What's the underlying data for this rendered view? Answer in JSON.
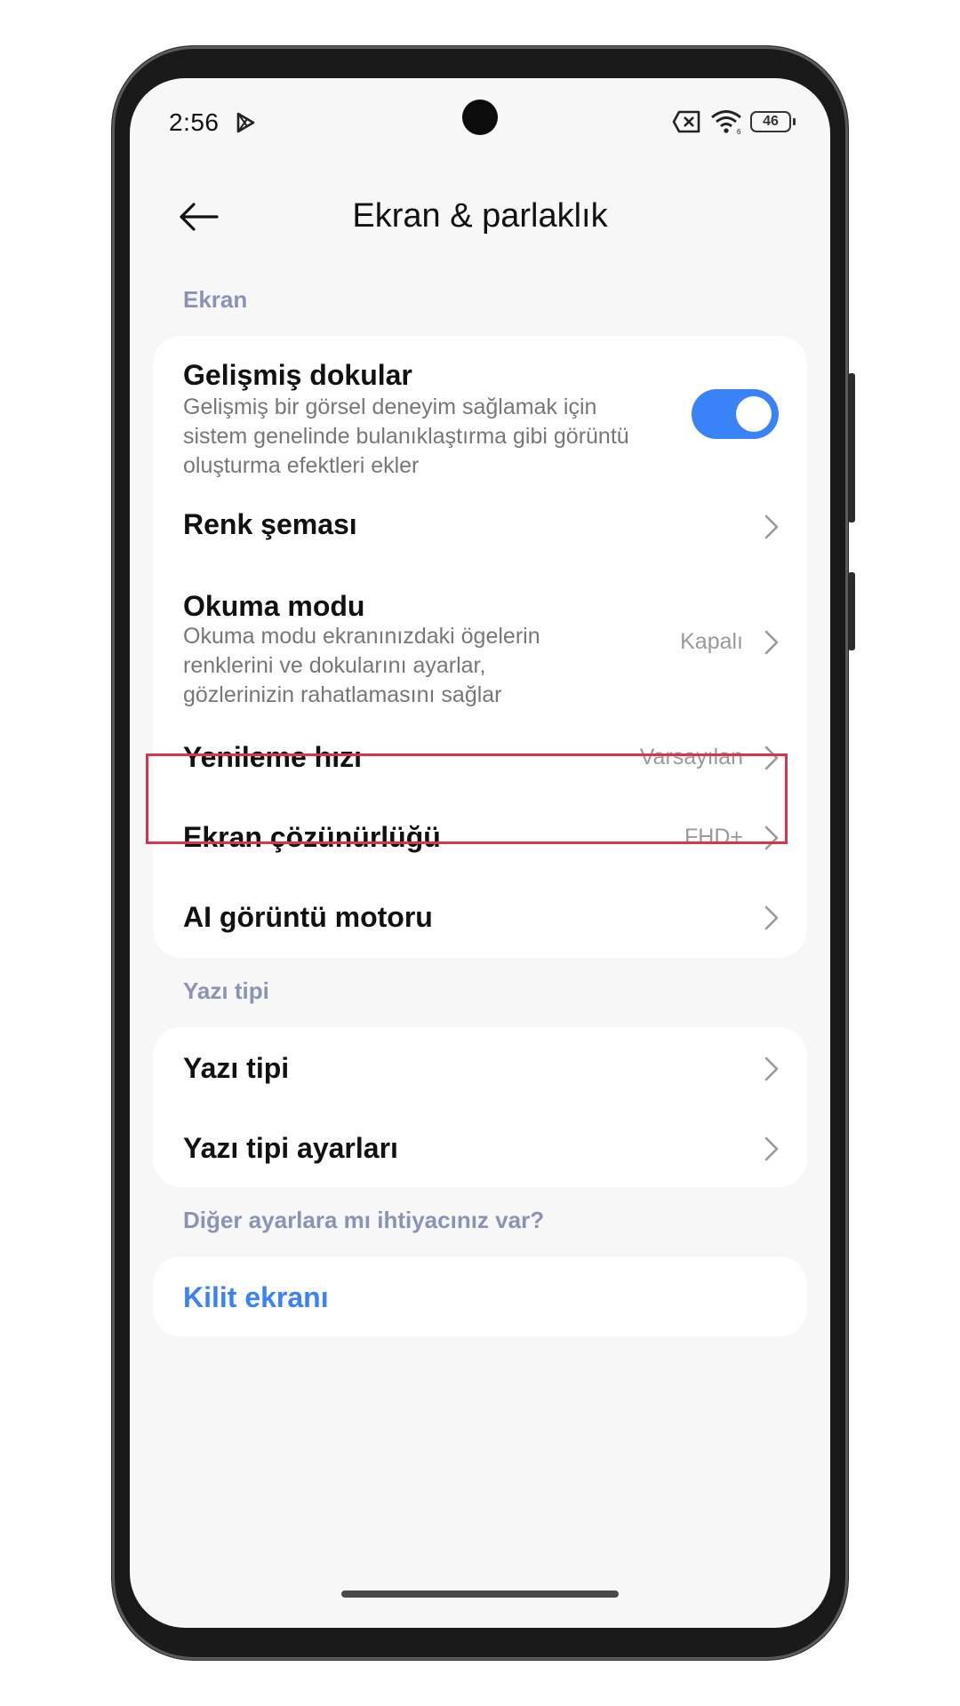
{
  "status_bar": {
    "time": "2:56",
    "battery_level": "46",
    "icons": [
      "play-store-icon",
      "sim-x-icon",
      "wifi-icon",
      "battery-icon"
    ]
  },
  "header": {
    "title": "Ekran & parlaklık",
    "back_icon": "arrow-left-icon"
  },
  "sections": {
    "ekran": {
      "label": "Ekran",
      "items": {
        "gelismis": {
          "title": "Gelişmiş dokular",
          "description": "Gelişmiş bir görsel deneyim sağlamak için sistem genelinde bulanıklaştırma gibi görüntü oluşturma efektleri ekler",
          "toggle_on": true
        },
        "renk": {
          "title": "Renk şeması"
        },
        "okuma": {
          "title": "Okuma modu",
          "description": "Okuma modu ekranınızdaki ögelerin renklerini ve dokularını ayarlar, gözlerinizin rahatlamasını sağlar",
          "value": "Kapalı"
        },
        "yenileme": {
          "title": "Yenileme hızı",
          "value": "Varsayılan"
        },
        "cozunurluk": {
          "title": "Ekran çözünürlüğü",
          "value": "FHD+"
        },
        "ai": {
          "title": "AI görüntü motoru"
        }
      }
    },
    "yazi": {
      "label": "Yazı tipi",
      "items": {
        "tip": {
          "title": "Yazı tipi"
        },
        "ayarlar": {
          "title": "Yazı tipi ayarları"
        }
      }
    },
    "diger": {
      "label": "Diğer ayarlara mı ihtiyacınız var?",
      "items": {
        "kilit": {
          "title": "Kilit ekranı"
        }
      }
    }
  },
  "colors": {
    "accent": "#3a82f7",
    "section_label": "#8a93b3",
    "highlight_border": "#d6344f",
    "background": "#f7f7f7",
    "card": "#ffffff"
  }
}
